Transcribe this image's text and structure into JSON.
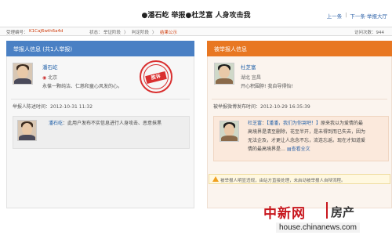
{
  "page": {
    "title": "●潘石屹 举报●杜芝富 人身攻击我",
    "nav_prev": "上一条",
    "nav_sep": "|",
    "nav_next": "下一条·举报大厅"
  },
  "infobar": {
    "id_label": "受理编号：",
    "id_value": "K1CaJ6wth6a4d",
    "status_label": "状态：",
    "stage_1": "举证阶段",
    "stage_2": "判定阶段",
    "stage_3": "结果公示",
    "stage_sep": "〉",
    "visits_label": "访问次数：944"
  },
  "reporter": {
    "header": "举报人信息 (共1人举报)",
    "name": "潘石屹",
    "location": "北京",
    "bio": "永葆一颗纯洁、仁慈和童心风发的心。",
    "stamp_text": "胜诉",
    "statement_label": "举报人陈述时间：2012-10-31 11:32",
    "message_name": "潘石屹",
    "message_text": "：此用户发布不实信息进行人身攻击、恶意抹黑"
  },
  "reported": {
    "header": "被举报人信息",
    "name": "杜芝富",
    "location": "湖北  宜昌",
    "bio": "开心积围脖!  我自导得怡!",
    "post_label": "被举报微博发布时间：2012-10-29 16:35:39",
    "post_name": "杜芝富",
    "post_tag": "【潘潘，我们为你哭吧！】",
    "post_line1": "原来我以为爱情的最",
    "post_line2": "高境界是清至删除，花至半开，是未得到而已失去，因为",
    "post_line3": "无法企及，才更让人念念不忘，流连忘返。现在才知道爱",
    "post_line4": "情的最高境界是…",
    "post_more": "查看全文",
    "warning": "被举报人明显违规，由站方直接处理，未启动被举报人自辩流程。"
  },
  "watermark": {
    "brand": "中新网",
    "channel": "房产",
    "url": "house.chinanews.com"
  },
  "colors": {
    "reporter_header": "#4a80c4",
    "reported_header": "#e87722",
    "stamp_red": "#d93030",
    "link_blue": "#1f5fa8",
    "brand_red": "#c8161d"
  }
}
